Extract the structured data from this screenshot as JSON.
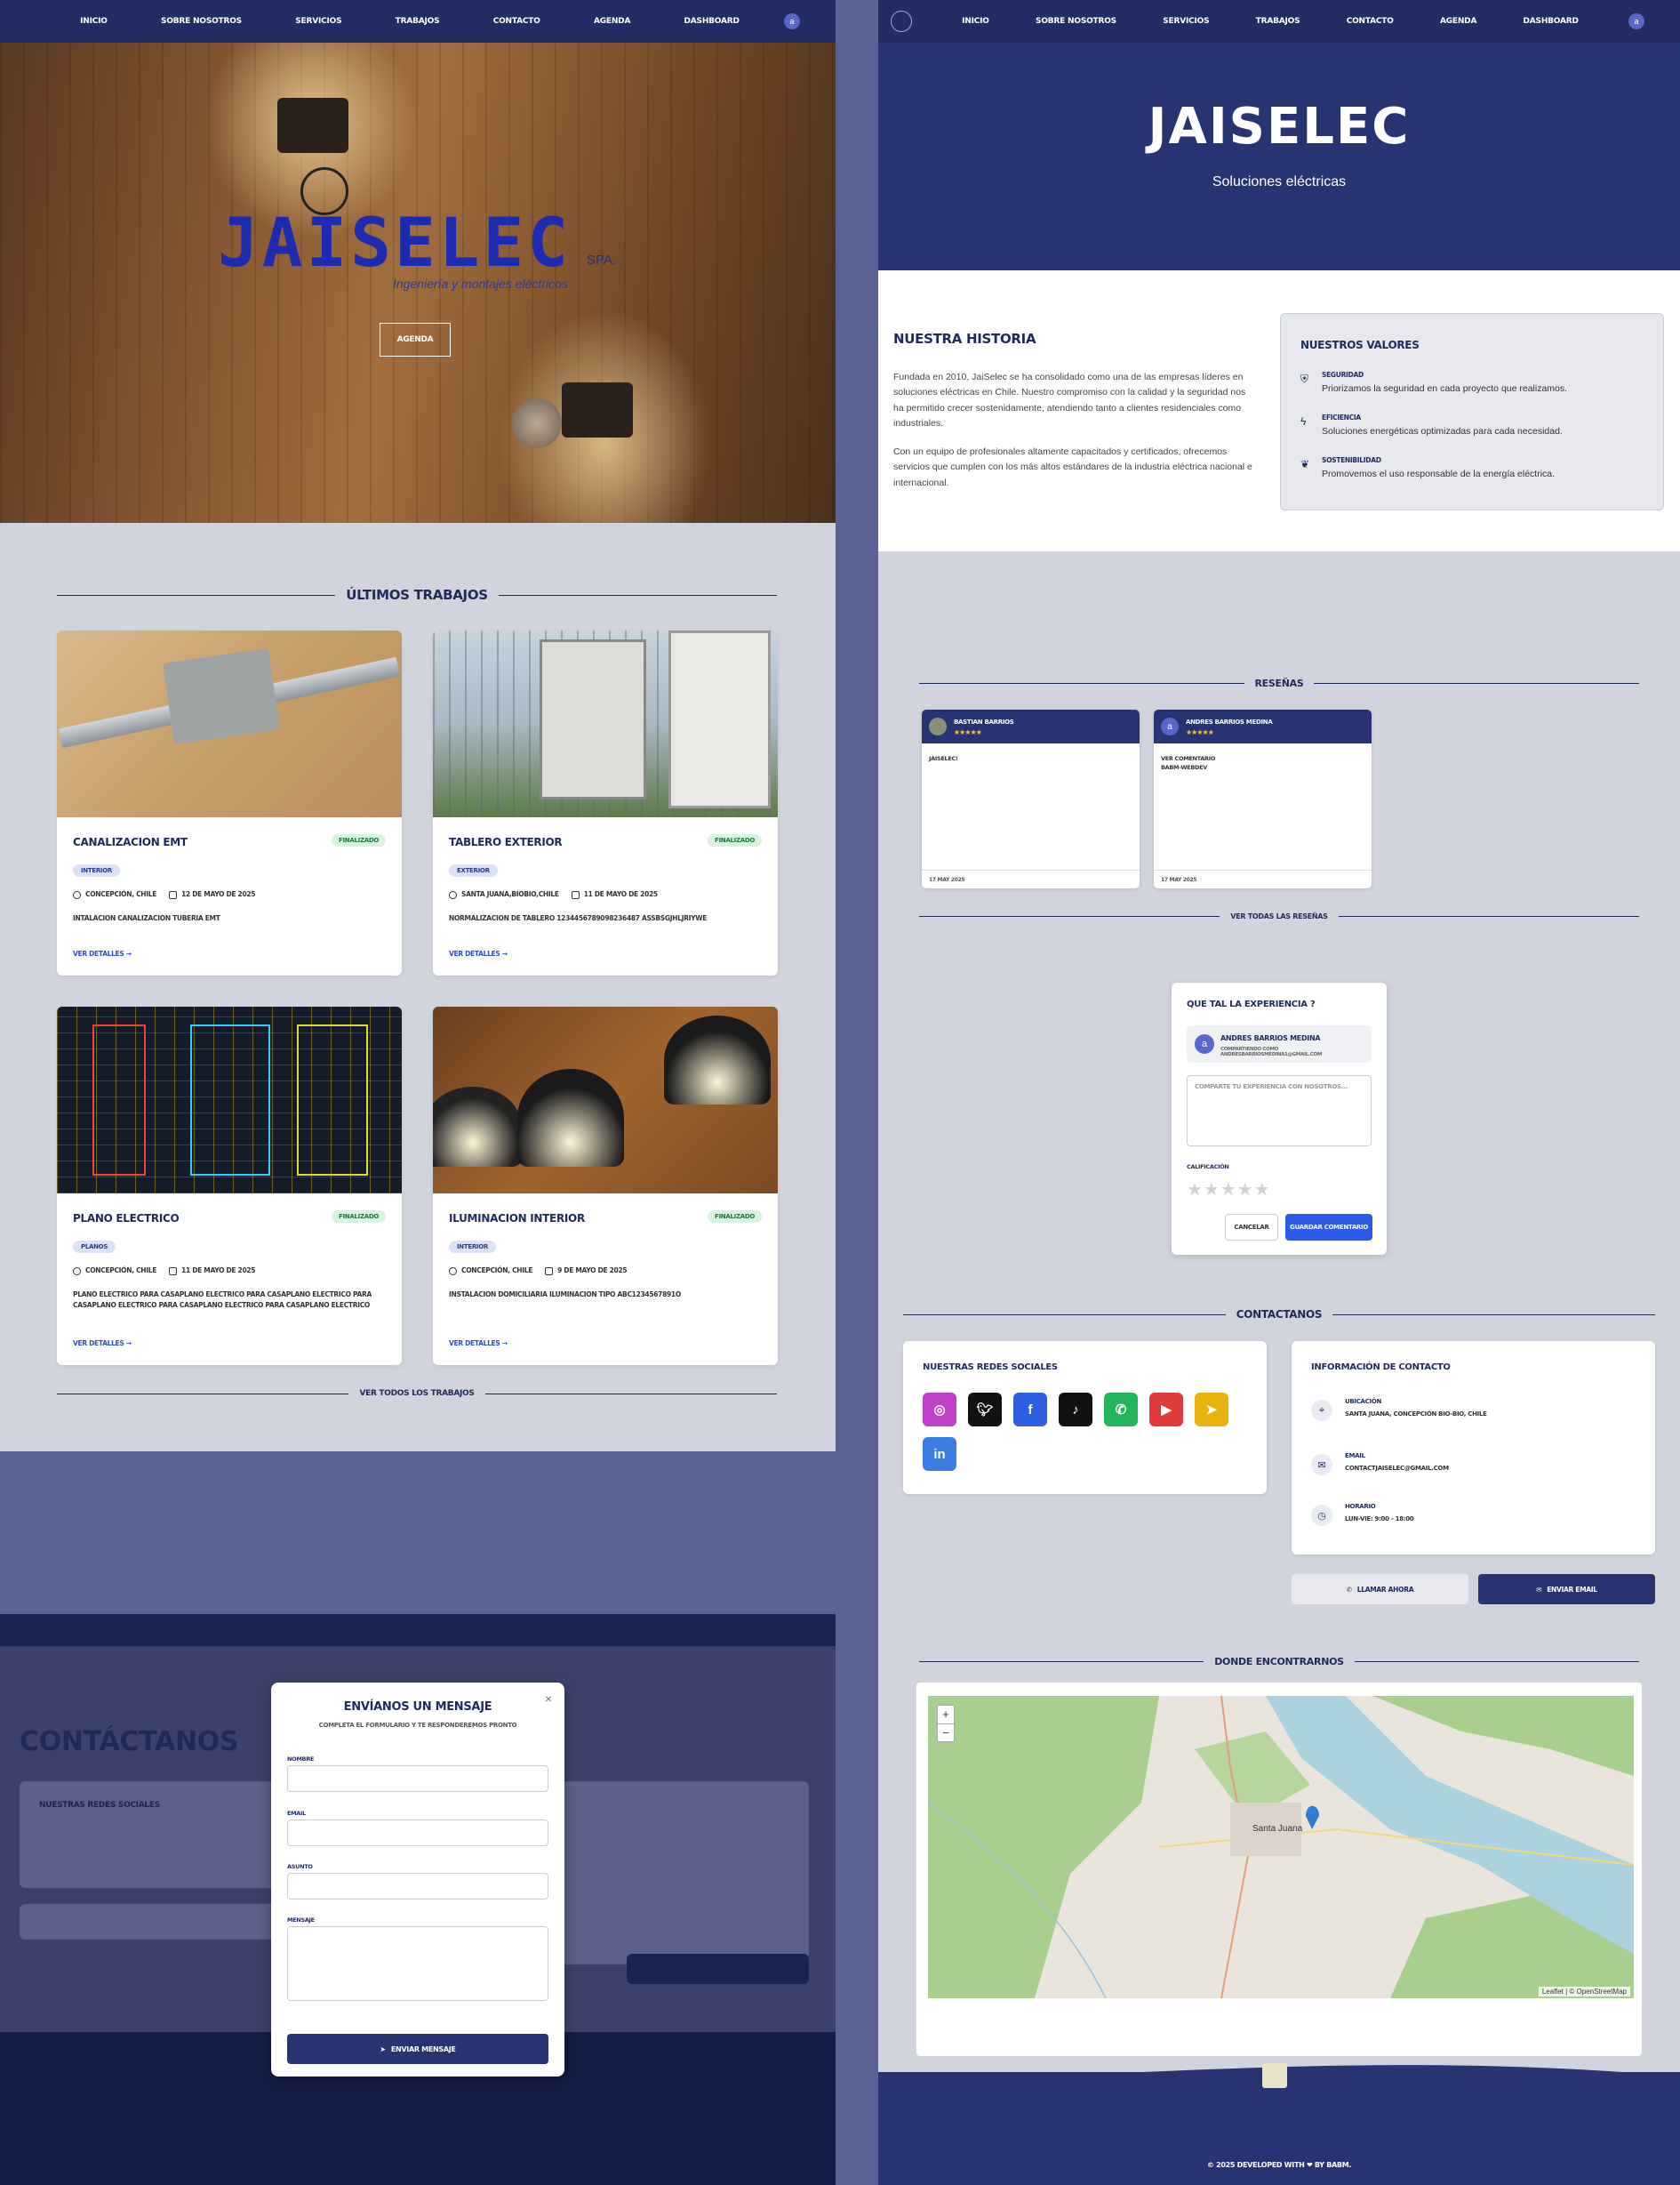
{
  "nav": {
    "items": [
      "INICIO",
      "SOBRE NOSOTROS",
      "SERVICIOS",
      "TRABAJOS",
      "CONTACTO",
      "AGENDA",
      "DASHBOARD"
    ],
    "avatar": "a"
  },
  "hero": {
    "brand": "JAISELEC",
    "spa": "SPA.",
    "tagline": "Ingeniería y montajes eléctricos",
    "cta": "AGENDA"
  },
  "jobs": {
    "title": "ÚLTIMOS TRABAJOS",
    "view_all": "VER TODOS LOS TRABAJOS",
    "more": "VER DETALLES →",
    "cards": [
      {
        "title": "CANALIZACION EMT",
        "status": "FINALIZADO",
        "tag": "INTERIOR",
        "place": "CONCEPCIÓN, CHILE",
        "date": "12 DE MAYO DE 2025",
        "desc": "INTALACION CANALIZACION TUBERIA EMT"
      },
      {
        "title": "TABLERO EXTERIOR",
        "status": "FINALIZADO",
        "tag": "EXTERIOR",
        "place": "SANTA JUANA,BIOBIO,CHILE",
        "date": "11 DE MAYO DE 2025",
        "desc": "NORMALIZACION DE TABLERO 1234456789098236487 ASSBSGJHLJRIYWE"
      },
      {
        "title": "PLANO ELECTRICO",
        "status": "FINALIZADO",
        "tag": "PLANOS",
        "place": "CONCEPCIÓN, CHILE",
        "date": "11 DE MAYO DE 2025",
        "desc": "PLANO ELECTRICO PARA CASAPLANO ELECTRICO PARA CASAPLANO ELECTRICO PARA CASAPLANO ELECTRICO PARA CASAPLANO ELECTRICO PARA CASAPLANO ELECTRICO PARA CASAPLANO ELECTRICO..."
      },
      {
        "title": "ILUMINACION INTERIOR",
        "status": "FINALIZADO",
        "tag": "INTERIOR",
        "place": "CONCEPCIÓN, CHILE",
        "date": "9 DE MAYO DE 2025",
        "desc": "INSTALACION DOMICILIARIA ILUMINACION TIPO ABC1234567891O"
      }
    ]
  },
  "about": {
    "title": "JAISELEC",
    "subtitle": "Soluciones eléctricas",
    "story_title": "NUESTRA HISTORIA",
    "story_p1": "Fundada en 2010, JaiSelec se ha consolidado como una de las empresas líderes en soluciones eléctricas en Chile. Nuestro compromiso con la calidad y la seguridad nos ha permitido crecer sostenidamente, atendiendo tanto a clientes residenciales como industriales.",
    "story_p2": "Con un equipo de profesionales altamente capacitados y certificados, ofrecemos servicios que cumplen con los más altos estándares de la industria eléctrica nacional e internacional.",
    "values_title": "NUESTROS VALORES",
    "values": [
      {
        "t": "SEGURIDAD",
        "d": "Priorizamos la seguridad en cada proyecto que realizamos."
      },
      {
        "t": "EFICIENCIA",
        "d": "Soluciones energéticas optimizadas para cada necesidad."
      },
      {
        "t": "SOSTENIBILIDAD",
        "d": "Promovemos el uso responsable de la energía eléctrica."
      }
    ]
  },
  "reviews": {
    "title": "RESEÑAS",
    "view_all": "VER TODAS LAS RESEÑAS",
    "items": [
      {
        "name": "BASTIAN BARRIOS",
        "stars": "★★★★★",
        "text": "JAISELEC!",
        "date": "17 MAY 2025"
      },
      {
        "name": "ANDRES BARRIOS MEDINA",
        "stars": "★★★★★",
        "text": "VER COMENTARIO\nBABM-WEBDEV",
        "date": "17 MAY 2025",
        "avatar": "a"
      }
    ]
  },
  "comment": {
    "title": "QUE TAL LA EXPERIENCIA ?",
    "user": "ANDRES BARRIOS MEDINA",
    "email": "COMPARTIENDO COMO ANDRESBARRIOSMEDINA1@GMAIL.COM",
    "avatar": "a",
    "placeholder": "COMPARTE TU EXPERIENCIA CON NOSOTROS...",
    "rating_label": "CALIFICACIÓN",
    "stars": "★★★★★",
    "cancel": "CANCELAR",
    "save": "GUARDAR COMENTARIO"
  },
  "contact": {
    "title": "CONTACTANOS",
    "social_title": "NUESTRAS REDES SOCIALES",
    "info_title": "INFORMACIÓN DE CONTACTO",
    "socials": [
      {
        "name": "instagram",
        "color": "#c13fc9"
      },
      {
        "name": "twitter",
        "color": "#111111"
      },
      {
        "name": "facebook",
        "color": "#2d5fe0"
      },
      {
        "name": "tiktok",
        "color": "#111111"
      },
      {
        "name": "whatsapp",
        "color": "#22b65a"
      },
      {
        "name": "youtube",
        "color": "#e03b3b"
      },
      {
        "name": "telegram",
        "color": "#e8b10e"
      },
      {
        "name": "linkedin",
        "color": "#3b7de0"
      }
    ],
    "info": [
      {
        "t": "UBICACIÓN",
        "v": "SANTA JUANA, CONCEPCIÓN BIO-BIO, CHILE"
      },
      {
        "t": "EMAIL",
        "v": "CONTACTJAISELEC@GMAIL.COM"
      },
      {
        "t": "HORARIO",
        "v": "LUN-VIE: 9:00 - 18:00"
      }
    ],
    "call": "LLAMAR AHORA",
    "email_btn": "ENVIAR EMAIL"
  },
  "map": {
    "title": "DONDE ENCONTRARNOS",
    "attribution": "Leaflet | © OpenStreetMap",
    "town": "Santa Juana",
    "zoom_in": "+",
    "zoom_out": "−"
  },
  "footer": {
    "text": "© 2025 DEVELOPED WITH ❤ BY BABM."
  },
  "modal": {
    "title": "ENVÍANOS UN MENSAJE",
    "subtitle": "COMPLETA EL FORMULARIO Y TE RESPONDEREMOS PRONTO",
    "close": "×",
    "fields": [
      "NOMBRE",
      "EMAIL",
      "ASUNTO",
      "MENSAJE"
    ],
    "send": "ENVIAR MENSAJE",
    "bg_title": "CONTÁCTANOS",
    "bg_social": "NUESTRAS REDES SOCIALES"
  }
}
